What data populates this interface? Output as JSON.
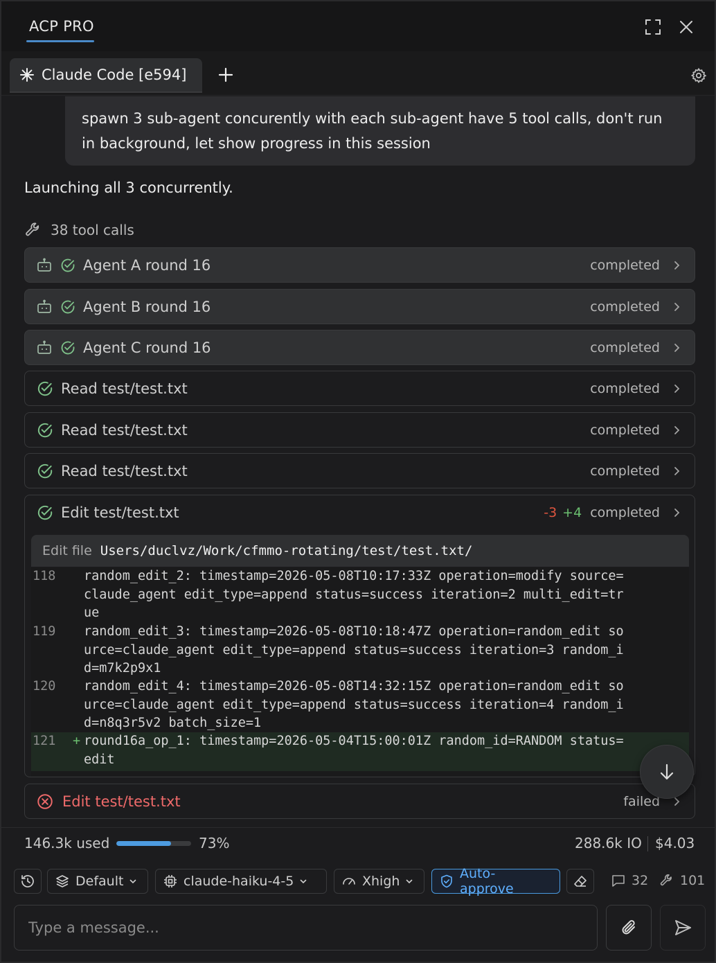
{
  "app": {
    "title": "ACP PRO"
  },
  "tabs": [
    {
      "label": "Claude Code [e594]"
    }
  ],
  "conversation": {
    "user_message": "spawn 3 sub-agent concurently with each sub-agent have 5 tool calls, don't run in background, let show progress in this session",
    "assistant_message": "Launching all 3 concurrently.",
    "tool_calls_summary": "38 tool calls"
  },
  "tool_calls": [
    {
      "kind": "agent",
      "name": "Agent A round 16",
      "status": "completed"
    },
    {
      "kind": "agent",
      "name": "Agent B round 16",
      "status": "completed"
    },
    {
      "kind": "agent",
      "name": "Agent C round 16",
      "status": "completed"
    },
    {
      "kind": "read",
      "name": "Read test/test.txt",
      "status": "completed"
    },
    {
      "kind": "read",
      "name": "Read test/test.txt",
      "status": "completed"
    },
    {
      "kind": "read",
      "name": "Read test/test.txt",
      "status": "completed"
    }
  ],
  "edit_call": {
    "name": "Edit test/test.txt",
    "removed": "-3",
    "added": "+4",
    "status": "completed",
    "file_label": "Edit file",
    "file_path": "Users/duclvz/Work/cfmmo-rotating/test/test.txt/",
    "lines": [
      {
        "num": "118",
        "marker": "",
        "text": "random_edit_2: timestamp=2026-05-08T10:17:33Z operation=modify source=\nclaude_agent edit_type=append status=success iteration=2 multi_edit=tr\nue"
      },
      {
        "num": "119",
        "marker": "",
        "text": "random_edit_3: timestamp=2026-05-08T10:18:47Z operation=random_edit so\nurce=claude_agent edit_type=append status=success iteration=3 random_i\nd=m7k2p9x1"
      },
      {
        "num": "120",
        "marker": "",
        "text": "random_edit_4: timestamp=2026-05-08T14:32:15Z operation=random_edit so\nurce=claude_agent edit_type=append status=success iteration=4 random_i\nd=n8q3r5v2 batch_size=1"
      },
      {
        "num": "121",
        "marker": "+",
        "text": "round16a_op_1: timestamp=2026-05-04T15:00:01Z random_id=RANDOM status=\nedit"
      }
    ]
  },
  "failed_call": {
    "name": "Edit test/test.txt",
    "status": "failed"
  },
  "usage": {
    "used": "146.3k used",
    "percent_label": "73%",
    "percent": 73,
    "io": "288.6k IO",
    "cost": "$4.03"
  },
  "toolbar": {
    "mode": "Default",
    "model": "claude-haiku-4-5",
    "effort": "Xhigh",
    "approve": "Auto-approve",
    "messages_count": "32",
    "tools_count": "101"
  },
  "composer": {
    "placeholder": "Type a message..."
  },
  "colors": {
    "accent": "#4a9ae0",
    "success": "#6cc070",
    "danger": "#e0553f"
  }
}
